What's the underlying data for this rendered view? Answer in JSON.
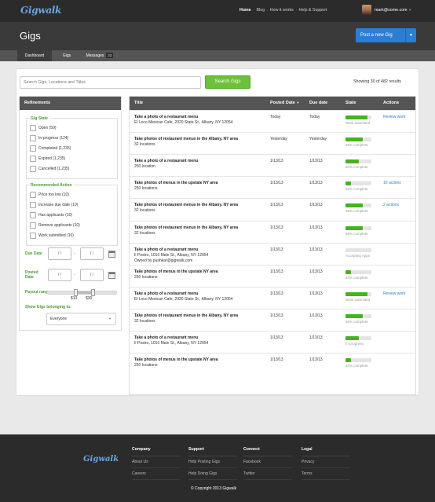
{
  "topbar": {
    "logo": "Gigwalk",
    "nav": [
      "Home",
      "Blog",
      "How it works",
      "Help & Support"
    ],
    "user_email": "mark@some.com"
  },
  "header": {
    "title": "Gigs",
    "post_button": "Post a new Gig"
  },
  "tabs": [
    {
      "label": "Dashboard"
    },
    {
      "label": "Gigs"
    },
    {
      "label": "Messages",
      "count": "23"
    }
  ],
  "search": {
    "placeholder": "Search Gigs, Locations and Titles",
    "button": "Search Gigs",
    "results_text": "Showing 30 of 482 results"
  },
  "refinements": {
    "title": "Refinements",
    "gig_state_title": "Gig State",
    "gig_states": [
      "Open (50)",
      "In-progress (124)",
      "Completed (1,235)",
      "Expired (1,235)",
      "Cancelled (1,235)"
    ],
    "recommended_title": "Recommended Action",
    "recommended": [
      "Price too low (10)",
      "Increase due date (10)",
      "Has applicants (10)",
      "Remove applicants (10)",
      "Work submitted (10)"
    ],
    "due_date_label": "Due Date",
    "posted_date_label": "Posted Date",
    "date_placeholder": "/ /",
    "payout_label": "Payout range",
    "payout_min": "$10",
    "payout_max": "$30",
    "belonging_label": "Show Gigs belonging to:",
    "belonging_value": "Everyone"
  },
  "table": {
    "headers": {
      "title": "Title",
      "posted": "Posted Date",
      "due": "Due date",
      "state": "State",
      "actions": "Actions"
    },
    "rows": [
      {
        "title": "Take a photo of a restaurant menu",
        "sub": "El Loco Mexican Cafe, 2020 State St., Albany, NY 12054",
        "sub2": "",
        "posted": "Today",
        "due": "Today",
        "progress": 0.85,
        "state": "Work submitted",
        "action": "Review work"
      },
      {
        "title": "Take photos of restaurant menus in the Albany, NY area",
        "sub": "32 locations",
        "sub2": "",
        "posted": "Yesterday",
        "due": "Yesterday",
        "progress": 0.66,
        "state": "66% complete",
        "action": ""
      },
      {
        "title": "Take a photo of a restaurant menu",
        "sub": "250 location",
        "sub2": "",
        "posted": "1/13/13",
        "due": "1/13/13",
        "progress": 0.5,
        "state": "50% complete",
        "action": ""
      },
      {
        "title": "Take photos of menus in the upstate NY area",
        "sub": "250 locations",
        "sub2": "",
        "posted": "1/13/13",
        "due": "1/13/13",
        "progress": 0.2,
        "state": "20% complete",
        "action": "16 actions"
      },
      {
        "title": "Take photos of restaurant menus in the Albany, NY area",
        "sub": "32 locations",
        "sub2": "",
        "posted": "1/13/13",
        "due": "1/13/13",
        "progress": 0.66,
        "state": "66% complete",
        "action": "2 actions"
      },
      {
        "title": "Take photos of restaurant menus in the Albany, NY area",
        "sub": "32 locations",
        "sub2": "",
        "posted": "1/13/13",
        "due": "1/13/13",
        "progress": 0.66,
        "state": "66% complete",
        "action": ""
      },
      {
        "title": "Take a photo of a restaurant menu",
        "sub": "Il Postro, 1010 Main St., Albany, NY 12054",
        "sub2": "Owned by pushkar@gigwalk.com",
        "posted": "1/13/13",
        "due": "1/13/13",
        "progress": 0,
        "state": "Accepting Apps",
        "action": ""
      },
      {
        "title": "Take photos of menus in the upstate NY area",
        "sub": "250 locations",
        "sub2": "",
        "posted": "1/13/13",
        "due": "1/13/13",
        "progress": 0.2,
        "state": "20% complete",
        "action": ""
      },
      {
        "title": "Take a photo of a restaurant menu",
        "sub": "El Loco Mexican Cafe, 2020 State St., Albany, NY 12054",
        "sub2": "",
        "posted": "1/13/13",
        "due": "1/13/13",
        "progress": 0.85,
        "state": "Work submitted",
        "action": "Review work"
      },
      {
        "title": "Take photos of restaurant menus in the Albany, NY area",
        "sub": "32 locations",
        "sub2": "",
        "posted": "1/13/13",
        "due": "1/13/13",
        "progress": 0.66,
        "state": "66% complete",
        "action": ""
      },
      {
        "title": "Take a photo of a restaurant menu",
        "sub": "Il Postro, 1010 Main St., Albany, NY 12054",
        "sub2": "",
        "posted": "1/13/13",
        "due": "1/13/13",
        "progress": 0.5,
        "state": "In-progress",
        "action": ""
      },
      {
        "title": "Take photos of menus in the upstate NY area",
        "sub": "250 locations",
        "sub2": "",
        "posted": "1/13/13",
        "due": "1/13/13",
        "progress": 0.2,
        "state": "20% complete",
        "action": ""
      }
    ]
  },
  "footer": {
    "logo": "Gigwalk",
    "columns": [
      {
        "title": "Company",
        "links": [
          "About Us",
          "Careers"
        ]
      },
      {
        "title": "Support",
        "links": [
          "Help Posting Gigs",
          "Help Doing Gigs"
        ]
      },
      {
        "title": "Connect",
        "links": [
          "Facebook",
          "Twitter"
        ]
      },
      {
        "title": "Legal",
        "links": [
          "Privacy",
          "Terms"
        ]
      }
    ],
    "copyright": "© Copyright 2013 Gigwalk"
  },
  "colors": {
    "accent_blue": "#2b7ed3",
    "accent_green": "#6cc03a",
    "progress_green": "#45b320",
    "dark": "#2b2b2b"
  }
}
